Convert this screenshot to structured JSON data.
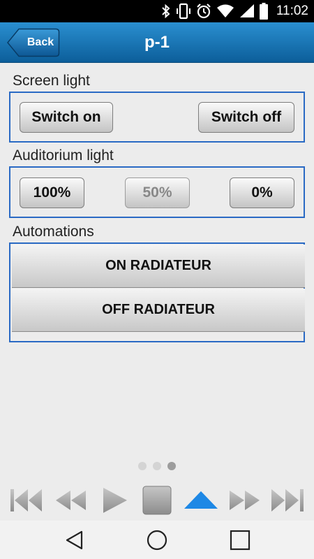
{
  "status_bar": {
    "time": "11:02",
    "icons": [
      "bluetooth-icon",
      "vibrate-icon",
      "alarm-icon",
      "wifi-icon",
      "signal-icon",
      "battery-icon"
    ]
  },
  "header": {
    "back_label": "Back",
    "title": "p-1",
    "color": "#1a73b8"
  },
  "screen_light": {
    "label": "Screen light",
    "buttons": [
      {
        "label": "Switch on"
      },
      {
        "label": "Switch off"
      }
    ]
  },
  "auditorium_light": {
    "label": "Auditorium light",
    "buttons": [
      {
        "label": "100%",
        "enabled": true
      },
      {
        "label": "50%",
        "enabled": false
      },
      {
        "label": "0%",
        "enabled": true
      }
    ]
  },
  "automations": {
    "label": "Automations",
    "buttons": [
      {
        "label": "ON RADIATEUR"
      },
      {
        "label": "OFF RADIATEUR"
      }
    ]
  },
  "pager": {
    "count": 3,
    "active_index": 2
  },
  "media_controls": [
    "skip-to-start-icon",
    "rewind-icon",
    "play-icon",
    "stop-icon",
    "eject-icon",
    "fast-forward-icon",
    "skip-to-end-icon"
  ],
  "nav_bar": [
    "back-nav-icon",
    "home-nav-icon",
    "recents-nav-icon"
  ],
  "colors": {
    "accent": "#1a73b8",
    "group_border": "#2a6ac4",
    "eject_active": "#1e88e5"
  }
}
